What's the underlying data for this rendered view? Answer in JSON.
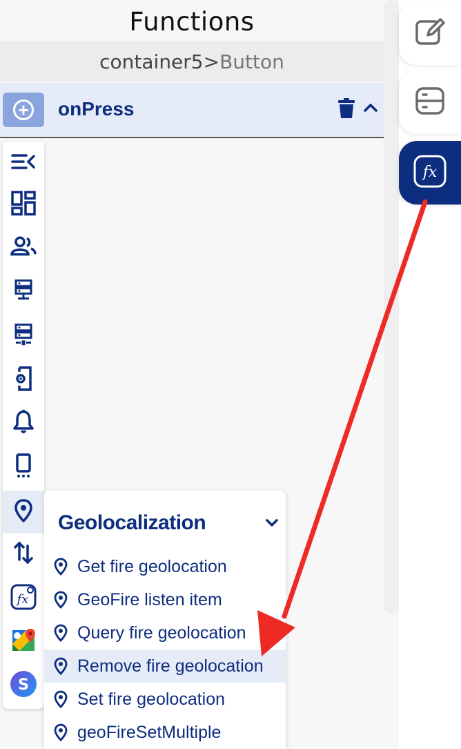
{
  "header": {
    "title": "Functions"
  },
  "breadcrumb": {
    "container": "container5>",
    "target": "Button"
  },
  "event": {
    "name": "onPress",
    "add_icon": "plus-circle-icon",
    "delete_icon": "trash-icon",
    "collapse_icon": "chevron-up-icon"
  },
  "right_tabs": [
    {
      "icon": "edit-icon",
      "active": false
    },
    {
      "icon": "database-icon",
      "active": false
    },
    {
      "icon": "fx-icon",
      "active": true
    }
  ],
  "categories": [
    {
      "icon": "collapse-menu-icon"
    },
    {
      "icon": "dashboard-icon"
    },
    {
      "icon": "users-icon"
    },
    {
      "icon": "server-icon"
    },
    {
      "icon": "server-remove-icon"
    },
    {
      "icon": "device-settings-icon"
    },
    {
      "icon": "bell-icon"
    },
    {
      "icon": "mobile-icon"
    },
    {
      "icon": "location-pin-icon",
      "active": true
    },
    {
      "icon": "transfer-icon"
    },
    {
      "icon": "custom-fx-icon"
    },
    {
      "icon": "google-maps-icon"
    },
    {
      "icon": "s-logo-icon"
    }
  ],
  "geolocalization": {
    "title": "Geolocalization",
    "items": [
      {
        "label": "Get fire geolocation"
      },
      {
        "label": "GeoFire listen item"
      },
      {
        "label": "Query fire geolocation"
      },
      {
        "label": "Remove fire geolocation",
        "highlighted": true
      },
      {
        "label": "Set fire geolocation"
      },
      {
        "label": "geoFireSetMultiple"
      }
    ]
  },
  "colors": {
    "brand": "#0d2d7e",
    "highlight": "#e6ebf8",
    "annotation": "#ee2a24"
  }
}
